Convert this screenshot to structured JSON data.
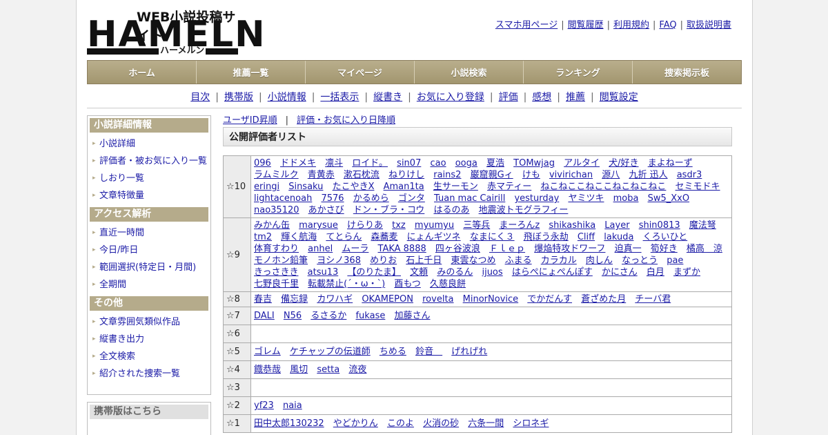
{
  "header": {
    "logo_tagline": "WEB小説投稿サイト",
    "logo_word": "HAMELN",
    "logo_kana": "ハーメルン",
    "top_links": [
      "スマホ用ページ",
      "閲覧履歴",
      "利用規約",
      "FAQ",
      "取扱説明書"
    ]
  },
  "nav": [
    "ホーム",
    "推薦一覧",
    "マイページ",
    "小説検索",
    "ランキング",
    "捜索掲示板"
  ],
  "subnav": [
    "目次",
    "携帯版",
    "小説情報",
    "一括表示",
    "縦書き",
    "お気に入り登録",
    "評価",
    "感想",
    "推薦",
    "閲覧設定"
  ],
  "sidebar": {
    "groups": [
      {
        "title": "小説詳細情報",
        "items": [
          "小説詳細",
          "評価者・被お気に入り一覧",
          "しおり一覧",
          "文章特徴量"
        ]
      },
      {
        "title": "アクセス解析",
        "items": [
          "直近一時間",
          "今日/昨日",
          "範囲選択(特定日・月間)",
          "全期間"
        ]
      },
      {
        "title": "その他",
        "items": [
          "文章雰囲気類似作品",
          "縦書き出力",
          "全文検索",
          "紹介された捜索一覧"
        ]
      }
    ],
    "mobile_title": "携帯版はこちら"
  },
  "main": {
    "sort_links": [
      "ユーザID昇順",
      "評価・お気に入り日降順"
    ],
    "list_title": "公開評価者リスト",
    "ratings": [
      {
        "label": "☆10",
        "names": [
          "096",
          "ドドメキ",
          "凛斗",
          "ロイド。",
          "sin07",
          "cao",
          "ooga",
          "夏浩",
          "TOMwjag",
          "アルタイ",
          "犬/好き",
          "まよねーず",
          "ラムミルク",
          "青黄赤",
          "漱石枕流",
          "ねりけし",
          "rains2",
          "巌窟親Gィ",
          "けも",
          "vivirichan",
          "源八",
          "九折 迅人",
          "asdr3",
          "eringi",
          "Sinsaku",
          "たこやきX",
          "Aman1ta",
          "生サーモン",
          "赤マティー",
          "ねこねここねここねこねこねこ",
          "セミモドキ",
          "lightacenoah",
          "7576",
          "かるめら",
          "ゴンタ",
          "Tuan mac Cairill",
          "yesturday",
          "ヤミツキ",
          "moba",
          "Sw5_XxO",
          "nao35120",
          "あかさび",
          "ドン・ブラ・コウ",
          "はるのあ",
          "地震波トモグラフィー"
        ]
      },
      {
        "label": "☆9",
        "names": [
          "みかん缶",
          "marysue",
          "けらりあ",
          "txz",
          "myumyu",
          "三等兵",
          "まーろんz",
          "shikashika",
          "Layer",
          "shin0813",
          "魔法弩",
          "tm2",
          "輝く航海",
          "てとらん",
          "森蕎麦",
          "にょんギツネ",
          "なまにく３",
          "飛ぼう永劫",
          "Cliff",
          "lakuda",
          "くろいひと",
          "体育すわり",
          "anhel",
          "ムーラ",
          "TAKA 8888",
          "四ヶ谷波浪",
          "Ｆｌｅｐ",
          "爆焔特攻ドワーフ",
          "迫真一",
          "筍好き",
          "橘高　涼",
          "モノホン鉛筆",
          "ヨシノ368",
          "めりお",
          "石上千日",
          "東雲なつめ",
          "ふまる",
          "カラカル",
          "肉しん",
          "なっとう",
          "pae",
          "きっさきき",
          "atsu13",
          "【のりたま】",
          "文頼",
          "みのるん",
          "ijuos",
          "はらぺにょぺんぽす",
          "かにさん",
          "白月",
          "まずか",
          "七野良千里",
          "転載禁止(´・ω・`)",
          "酉もつ",
          "久慈良餅"
        ]
      },
      {
        "label": "☆8",
        "names": [
          "春吉",
          "備忘録",
          "カワハギ",
          "OKAMEPON",
          "rovelta",
          "MinorNovice",
          "でかだんす",
          "蒼ざめた月",
          "チーバ君"
        ]
      },
      {
        "label": "☆7",
        "names": [
          "DALI",
          "N56",
          "るさるか",
          "fukase",
          "加藤さん"
        ]
      },
      {
        "label": "☆6",
        "names": []
      },
      {
        "label": "☆5",
        "names": [
          "ゴレム",
          "ケチャップの伝道師",
          "ちめる",
          "鈴音＿",
          "げれげれ"
        ]
      },
      {
        "label": "☆4",
        "names": [
          "鐡恭哉",
          "風切",
          "setta",
          "流夜"
        ]
      },
      {
        "label": "☆3",
        "names": []
      },
      {
        "label": "☆2",
        "names": [
          "yf23",
          "naia"
        ]
      },
      {
        "label": "☆1",
        "names": [
          "田中太郎130232",
          "やどかりん",
          "このよ",
          "火消の砂",
          "六条一間",
          "シロネギ"
        ]
      }
    ]
  }
}
